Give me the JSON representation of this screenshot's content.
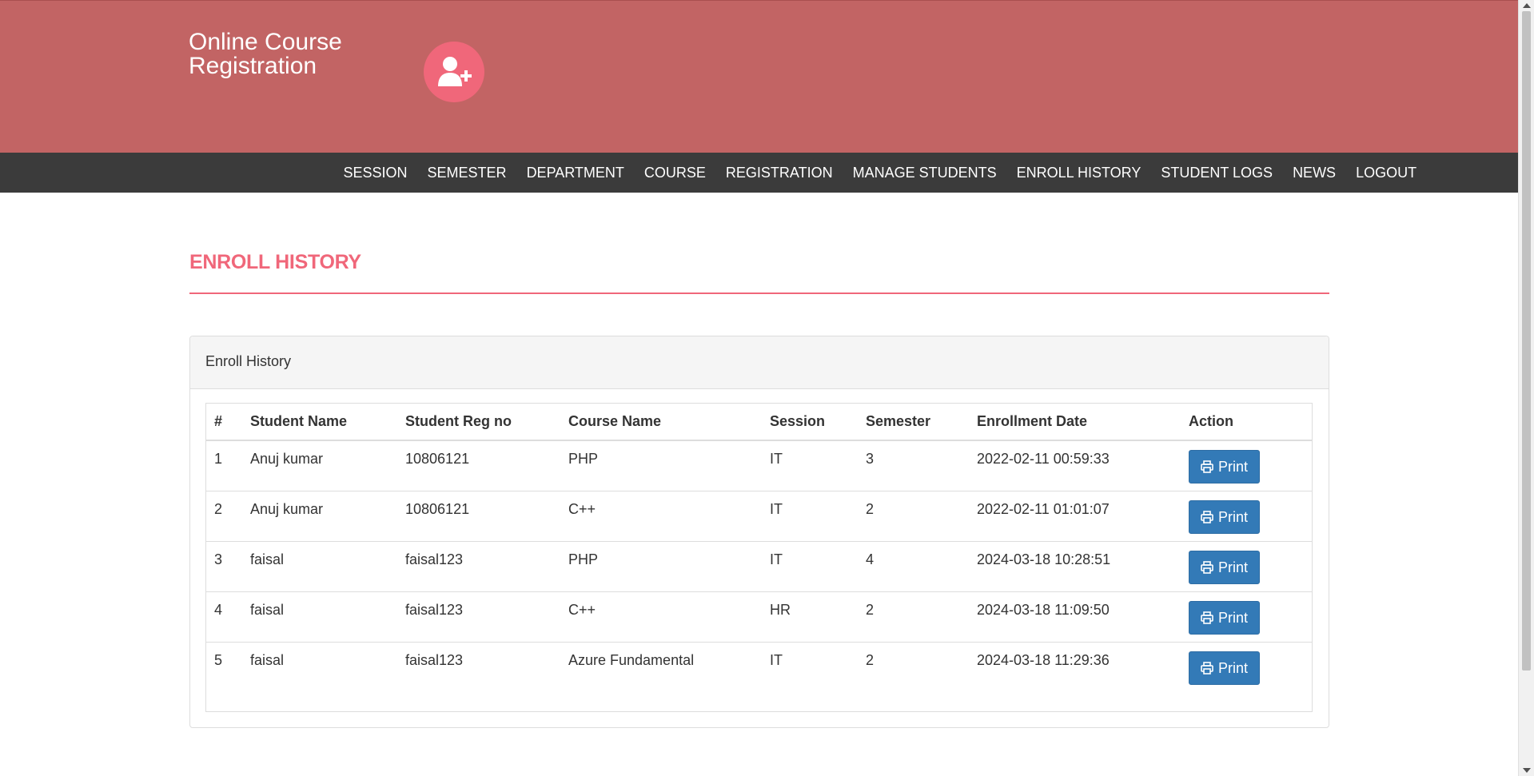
{
  "header": {
    "brand_line1": "Online Course",
    "brand_line2": "Registration"
  },
  "nav": [
    "SESSION",
    "SEMESTER",
    "DEPARTMENT",
    "COURSE",
    "REGISTRATION",
    "MANAGE STUDENTS",
    "ENROLL HISTORY",
    "STUDENT LOGS",
    "NEWS",
    "LOGOUT"
  ],
  "page_title": "ENROLL HISTORY",
  "panel": {
    "heading": "Enroll History",
    "columns": [
      "#",
      "Student Name",
      "Student Reg no",
      "Course Name",
      "Session",
      "Semester",
      "Enrollment Date",
      "Action"
    ],
    "rows": [
      {
        "num": "1",
        "name": "Anuj kumar",
        "reg": "10806121",
        "course": "PHP",
        "session": "IT",
        "semester": "3",
        "date": "2022-02-11 00:59:33",
        "action": "Print"
      },
      {
        "num": "2",
        "name": "Anuj kumar",
        "reg": "10806121",
        "course": "C++",
        "session": "IT",
        "semester": "2",
        "date": "2022-02-11 01:01:07",
        "action": "Print"
      },
      {
        "num": "3",
        "name": "faisal",
        "reg": "faisal123",
        "course": "PHP",
        "session": "IT",
        "semester": "4",
        "date": "2024-03-18 10:28:51",
        "action": "Print"
      },
      {
        "num": "4",
        "name": "faisal",
        "reg": "faisal123",
        "course": "C++",
        "session": "HR",
        "semester": "2",
        "date": "2024-03-18 11:09:50",
        "action": "Print"
      },
      {
        "num": "5",
        "name": "faisal",
        "reg": "faisal123",
        "course": "Azure Fundamental",
        "session": "IT",
        "semester": "2",
        "date": "2024-03-18 11:29:36",
        "action": "Print"
      }
    ]
  },
  "icons": {
    "logo": "user-plus-icon",
    "print": "print-icon"
  },
  "colors": {
    "header_bg": "#c26464",
    "navbar_bg": "#3b3b3b",
    "accent": "#f0677a",
    "button_bg": "#337ab7"
  }
}
